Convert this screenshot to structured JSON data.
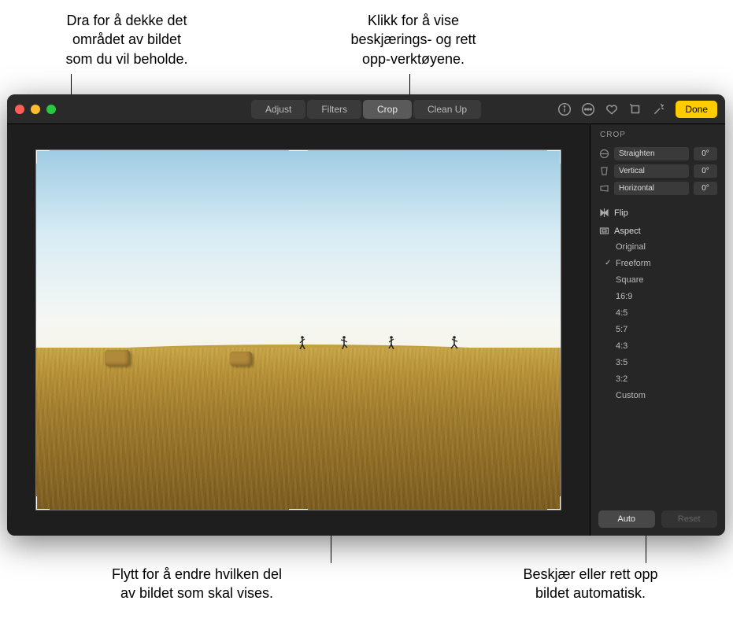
{
  "callouts": {
    "top_left": "Dra for å dekke det\nområdet av bildet\nsom du vil beholde.",
    "top_right": "Klikk for å vise\nbeskjærings- og rett\nopp-verktøyene.",
    "bottom_left": "Flytt for å endre hvilken del\nav bildet som skal vises.",
    "bottom_right": "Beskjær eller rett opp\nbildet automatisk."
  },
  "toolbar": {
    "tabs": {
      "adjust": "Adjust",
      "filters": "Filters",
      "crop": "Crop",
      "cleanup": "Clean Up"
    },
    "done": "Done"
  },
  "sidebar": {
    "title": "CROP",
    "sliders": {
      "straighten": {
        "label": "Straighten",
        "value": "0°"
      },
      "vertical": {
        "label": "Vertical",
        "value": "0°"
      },
      "horizontal": {
        "label": "Horizontal",
        "value": "0°"
      }
    },
    "flip": "Flip",
    "aspect": "Aspect",
    "aspect_options": {
      "original": "Original",
      "freeform": "Freeform",
      "square": "Square",
      "r16_9": "16:9",
      "r4_5": "4:5",
      "r5_7": "5:7",
      "r4_3": "4:3",
      "r3_5": "3:5",
      "r3_2": "3:2",
      "custom": "Custom"
    },
    "footer": {
      "auto": "Auto",
      "reset": "Reset"
    }
  }
}
